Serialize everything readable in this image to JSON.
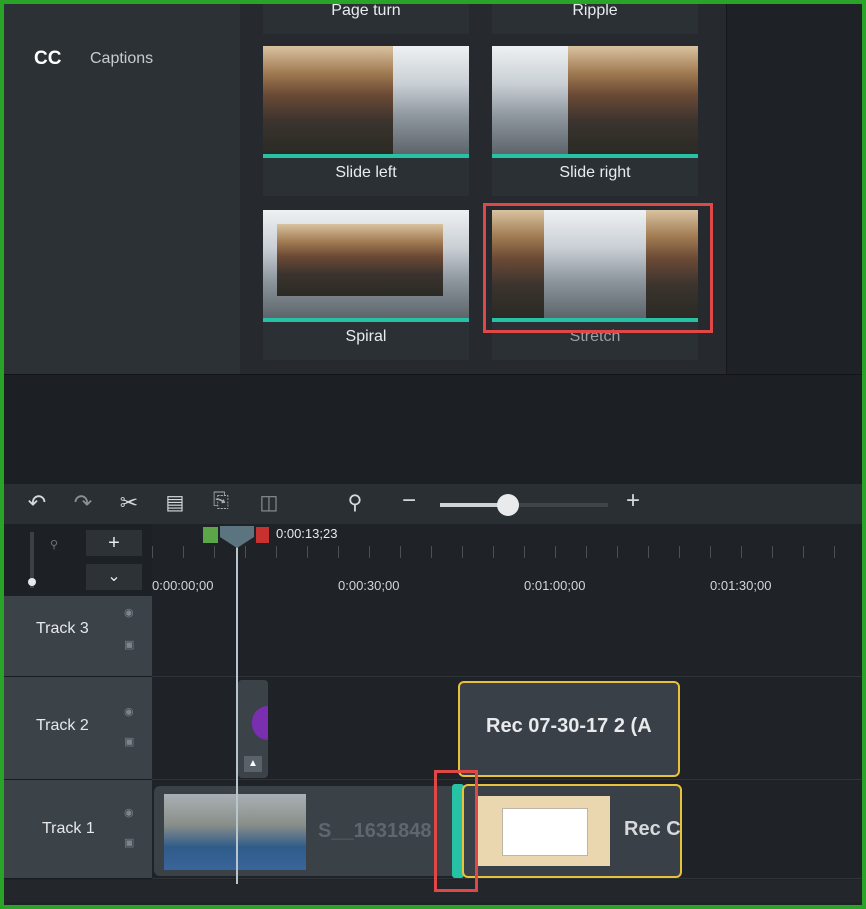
{
  "sidebar": {
    "captions_icon": "CC",
    "captions_label": "Captions"
  },
  "transitions": {
    "top_row_partial": [
      "Page turn",
      "Ripple"
    ],
    "tiles": [
      {
        "label": "Slide left"
      },
      {
        "label": "Slide right"
      },
      {
        "label": "Spiral"
      },
      {
        "label": "Stretch",
        "highlighted": true
      }
    ]
  },
  "toolbar": {
    "icons": [
      "undo-icon",
      "redo-icon",
      "cut-icon",
      "copy-icon",
      "paste-icon",
      "split-icon",
      "zoom-search-icon"
    ],
    "zoom_minus": "−",
    "zoom_plus": "+",
    "zoom_level": 0.38
  },
  "timeline": {
    "add_track": "+",
    "collapse": "⌄",
    "playhead_time": "0:00:13;23",
    "ruler_labels": [
      "0:00:00;00",
      "0:00:30;00",
      "0:01:00;00",
      "0:01:30;00"
    ]
  },
  "tracks": [
    {
      "name": "Track 3"
    },
    {
      "name": "Track 2",
      "clips": [
        {
          "label": "Rec 07-30-17 2 (A"
        }
      ]
    },
    {
      "name": "Track 1",
      "clips": [
        {
          "label": "S__1631848"
        },
        {
          "label": "Rec C"
        }
      ]
    }
  ],
  "colors": {
    "accent_teal": "#27c2a6",
    "selection_yellow": "#e8c23a",
    "highlight_red": "#e04848",
    "frame_green": "#2aa329"
  }
}
